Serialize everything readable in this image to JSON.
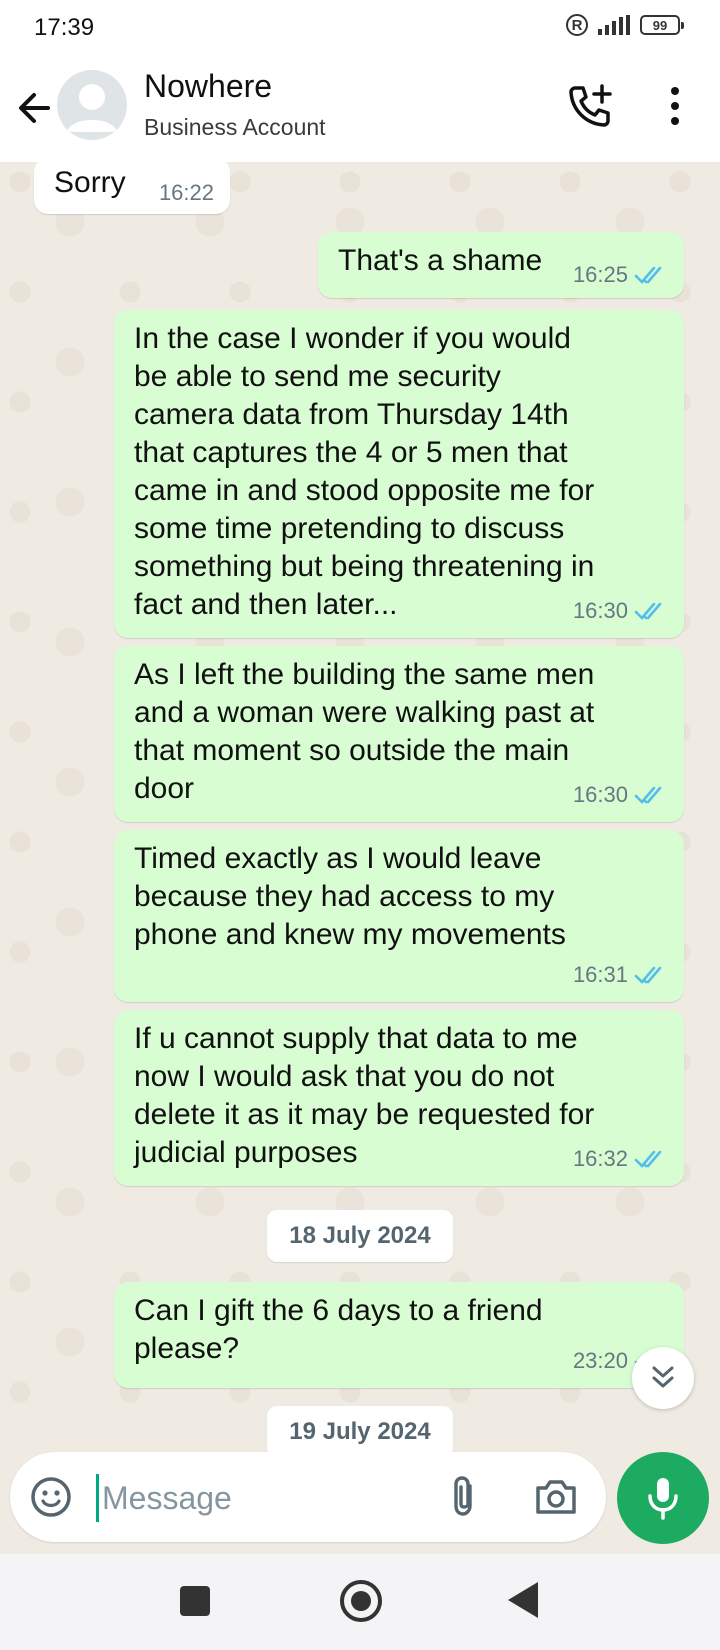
{
  "status_bar": {
    "time": "17:39",
    "registered_symbol": "R",
    "battery_level": "99"
  },
  "header": {
    "contact_name": "Nowhere",
    "contact_subtitle": "Business Account",
    "icons": [
      "back-arrow-icon",
      "avatar",
      "add-call-icon",
      "more-vert-icon"
    ]
  },
  "messages": [
    {
      "direction": "in",
      "text": "Sorry",
      "time": "16:22"
    },
    {
      "direction": "out",
      "text": "That's a shame",
      "time": "16:25",
      "status": "read"
    },
    {
      "direction": "out",
      "text": "In the case I wonder if you would\nbe able to send me security\ncamera data from Thursday 14th\nthat captures the 4 or 5 men that\ncame in and stood opposite me for\nsome time pretending to discuss\nsomething but being threatening in\nfact and then later...",
      "time": "16:30",
      "status": "read"
    },
    {
      "direction": "out",
      "text": "As I left the building the same men\nand a woman were walking past at\nthat moment so outside the main\ndoor",
      "time": "16:30",
      "status": "read"
    },
    {
      "direction": "out",
      "text": "Timed exactly as I would leave\nbecause they had access to my\nphone and knew my movements",
      "time": "16:31",
      "status": "read"
    },
    {
      "direction": "out",
      "text": "If u cannot supply that data to me\nnow I would ask that you do not\ndelete it as it may be requested for\njudicial purposes",
      "time": "16:32",
      "status": "read"
    },
    {
      "direction": "out",
      "text": "Can I gift the 6 days to a friend\nplease?",
      "time": "23:20",
      "status": "read"
    }
  ],
  "date_separators": [
    "18 July 2024",
    "19 July 2024"
  ],
  "composer": {
    "placeholder": "Message"
  },
  "colors": {
    "outgoing_bubble": "#d9fdd3",
    "incoming_bubble": "#ffffff",
    "read_ticks": "#53bdeb",
    "mic_button": "#1daa61",
    "chat_background": "#efeae2"
  }
}
